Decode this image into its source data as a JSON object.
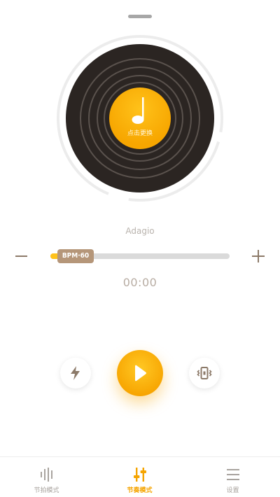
{
  "player": {
    "disc_label": "点击更换",
    "tempo_name": "Adagio",
    "bpm_label": "BPM·60",
    "bpm_value": 60,
    "timer": "00:00"
  },
  "icons": {
    "drag_handle": "drag-handle-icon",
    "music_note": "music-note-icon",
    "minus": "minus-icon",
    "plus": "plus-icon",
    "lightning": "lightning-icon",
    "play": "play-icon",
    "vibrate": "vibrate-icon",
    "beat_mode": "waveform-icon",
    "rhythm_mode": "sliders-icon",
    "settings": "menu-icon"
  },
  "colors": {
    "accent": "#f7a600",
    "record": "#2b2522",
    "badge": "#b59679"
  },
  "tabs": [
    {
      "label": "节拍模式",
      "active": false
    },
    {
      "label": "节奏模式",
      "active": true
    },
    {
      "label": "设置",
      "active": false
    }
  ]
}
